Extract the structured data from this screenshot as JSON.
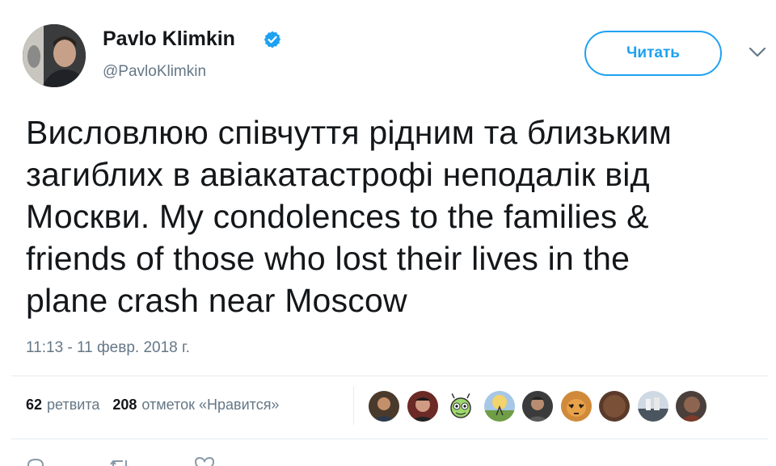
{
  "author": {
    "name": "Pavlo Klimkin",
    "handle": "@PavloKlimkin",
    "verified": true
  },
  "follow_button": {
    "label": "Читать"
  },
  "tweet": {
    "text": "Висловлюю співчуття рідним та близьким\nзагиблих в авіакатастрофі неподалік від\nМоскви. My condolences to the families &\nfriends of those who lost their lives in the\nplane crash near Moscow",
    "timestamp": "11:13 - 11 февр. 2018 г."
  },
  "stats": {
    "retweets_count": "62",
    "retweets_label": "ретвита",
    "likes_count": "208",
    "likes_label": "отметок «Нравится»"
  },
  "likers": [
    {
      "name": "liker-avatar-1"
    },
    {
      "name": "liker-avatar-2"
    },
    {
      "name": "liker-avatar-3"
    },
    {
      "name": "liker-avatar-4"
    },
    {
      "name": "liker-avatar-5"
    },
    {
      "name": "liker-avatar-6"
    },
    {
      "name": "liker-avatar-7"
    },
    {
      "name": "liker-avatar-8"
    },
    {
      "name": "liker-avatar-9"
    }
  ],
  "actions": {
    "reply_count": "",
    "retweet_count": "",
    "like_count": ""
  },
  "colors": {
    "accent": "#1da1f2",
    "text": "#14171a",
    "muted": "#657786",
    "divider": "#e6ecf0"
  }
}
